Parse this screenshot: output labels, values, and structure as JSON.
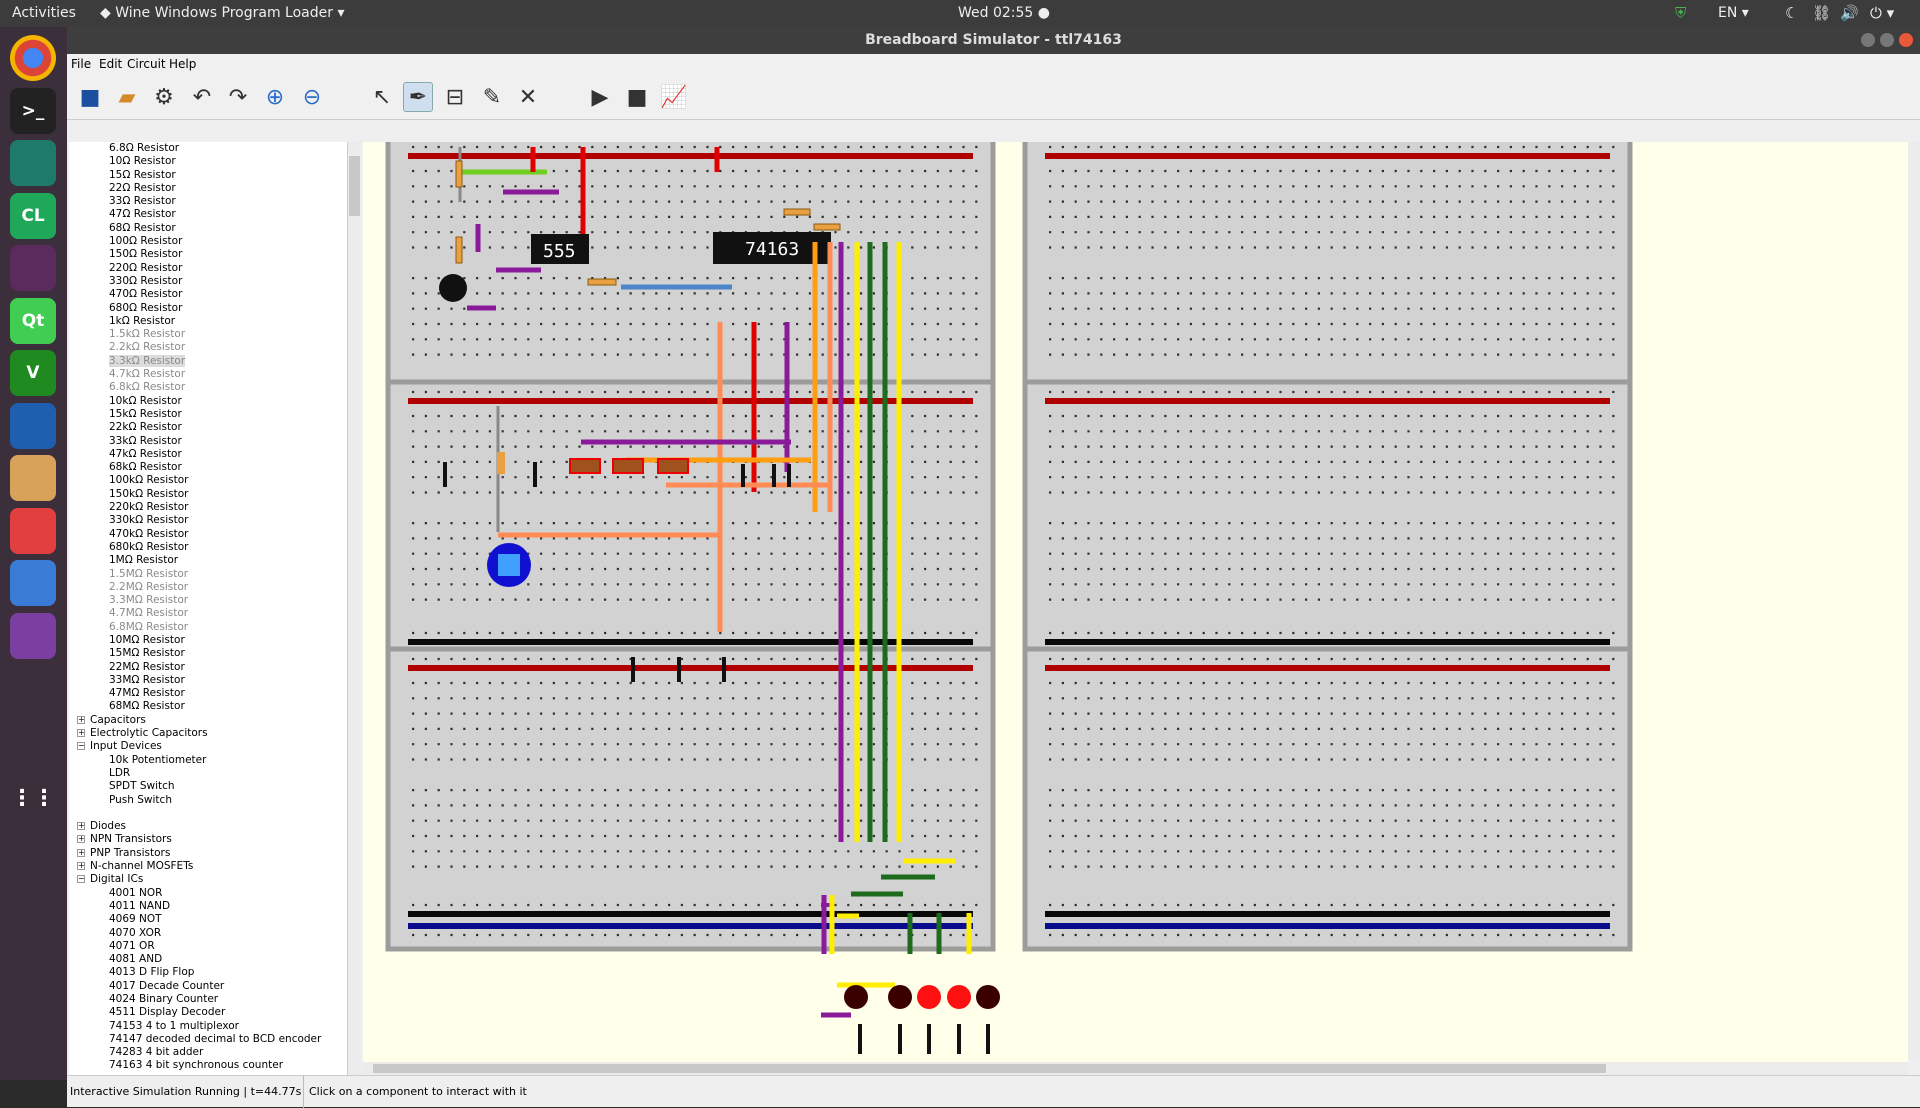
{
  "topbar": {
    "activities": "Activities",
    "app": "Wine Windows Program Loader",
    "clock": "Wed 02:55",
    "lang": "EN"
  },
  "launcher": [
    {
      "icon": "chrome-icon",
      "label": ""
    },
    {
      "icon": "terminal-icon",
      "label": ">_"
    },
    {
      "icon": "atom-icon",
      "label": ""
    },
    {
      "icon": "clion-icon",
      "label": "CL"
    },
    {
      "icon": "github-icon",
      "label": ""
    },
    {
      "icon": "qt-icon",
      "label": "Qt"
    },
    {
      "icon": "vim-icon",
      "label": "V"
    },
    {
      "icon": "writer-icon",
      "label": ""
    },
    {
      "icon": "files-icon",
      "label": ""
    },
    {
      "icon": "pdf-icon",
      "label": ""
    },
    {
      "icon": "editor-icon",
      "label": ""
    },
    {
      "icon": "wine-icon",
      "label": ""
    },
    {
      "icon": "apps-grid-icon",
      "label": ""
    }
  ],
  "window": {
    "title": "Breadboard Simulator - ttl74163"
  },
  "menu": {
    "file": "File",
    "edit": "Edit",
    "circuit": "Circuit",
    "help": "Help"
  },
  "tree": [
    {
      "text": "6.8Ω Resistor",
      "level": 2
    },
    {
      "text": "10Ω Resistor",
      "level": 2
    },
    {
      "text": "15Ω Resistor",
      "level": 2
    },
    {
      "text": "22Ω Resistor",
      "level": 2
    },
    {
      "text": "33Ω Resistor",
      "level": 2
    },
    {
      "text": "47Ω Resistor",
      "level": 2
    },
    {
      "text": "68Ω Resistor",
      "level": 2
    },
    {
      "text": "100Ω Resistor",
      "level": 2
    },
    {
      "text": "150Ω Resistor",
      "level": 2
    },
    {
      "text": "220Ω Resistor",
      "level": 2
    },
    {
      "text": "330Ω Resistor",
      "level": 2
    },
    {
      "text": "470Ω Resistor",
      "level": 2
    },
    {
      "text": "680Ω Resistor",
      "level": 2
    },
    {
      "text": "1kΩ Resistor",
      "level": 2
    },
    {
      "text": "1.5kΩ Resistor",
      "level": 2,
      "dim": true
    },
    {
      "text": "2.2kΩ Resistor",
      "level": 2,
      "dim": true
    },
    {
      "text": "3.3kΩ Resistor",
      "level": 2,
      "dim": true,
      "sel": true
    },
    {
      "text": "4.7kΩ Resistor",
      "level": 2,
      "dim": true
    },
    {
      "text": "6.8kΩ Resistor",
      "level": 2,
      "dim": true
    },
    {
      "text": "10kΩ Resistor",
      "level": 2
    },
    {
      "text": "15kΩ Resistor",
      "level": 2
    },
    {
      "text": "22kΩ Resistor",
      "level": 2
    },
    {
      "text": "33kΩ Resistor",
      "level": 2
    },
    {
      "text": "47kΩ Resistor",
      "level": 2
    },
    {
      "text": "68kΩ Resistor",
      "level": 2
    },
    {
      "text": "100kΩ Resistor",
      "level": 2
    },
    {
      "text": "150kΩ Resistor",
      "level": 2
    },
    {
      "text": "220kΩ Resistor",
      "level": 2
    },
    {
      "text": "330kΩ Resistor",
      "level": 2
    },
    {
      "text": "470kΩ Resistor",
      "level": 2
    },
    {
      "text": "680kΩ Resistor",
      "level": 2
    },
    {
      "text": "1MΩ Resistor",
      "level": 2
    },
    {
      "text": "1.5MΩ Resistor",
      "level": 2,
      "dim": true
    },
    {
      "text": "2.2MΩ Resistor",
      "level": 2,
      "dim": true
    },
    {
      "text": "3.3MΩ Resistor",
      "level": 2,
      "dim": true
    },
    {
      "text": "4.7MΩ Resistor",
      "level": 2,
      "dim": true
    },
    {
      "text": "6.8MΩ Resistor",
      "level": 2,
      "dim": true
    },
    {
      "text": "10MΩ Resistor",
      "level": 2
    },
    {
      "text": "15MΩ Resistor",
      "level": 2
    },
    {
      "text": "22MΩ Resistor",
      "level": 2
    },
    {
      "text": "33MΩ Resistor",
      "level": 2
    },
    {
      "text": "47MΩ Resistor",
      "level": 2
    },
    {
      "text": "68MΩ Resistor",
      "level": 2
    },
    {
      "text": "Capacitors",
      "level": 1,
      "exp": "+"
    },
    {
      "text": "Electrolytic Capacitors",
      "level": 1,
      "exp": "+"
    },
    {
      "text": "Input Devices",
      "level": 1,
      "exp": "−"
    },
    {
      "text": "10k Potentiometer",
      "level": 2
    },
    {
      "text": "LDR",
      "level": 2
    },
    {
      "text": "SPDT Switch",
      "level": 2
    },
    {
      "text": "Push Switch",
      "level": 2
    },
    {
      "text": "",
      "level": 2
    },
    {
      "text": "Diodes",
      "level": 1,
      "exp": "+"
    },
    {
      "text": "NPN Transistors",
      "level": 1,
      "exp": "+"
    },
    {
      "text": "PNP Transistors",
      "level": 1,
      "exp": "+"
    },
    {
      "text": "N-channel MOSFETs",
      "level": 1,
      "exp": "+"
    },
    {
      "text": "Digital ICs",
      "level": 1,
      "exp": "−"
    },
    {
      "text": "4001 NOR",
      "level": 2
    },
    {
      "text": "4011 NAND",
      "level": 2
    },
    {
      "text": "4069 NOT",
      "level": 2
    },
    {
      "text": "4070 XOR",
      "level": 2
    },
    {
      "text": "4071 OR",
      "level": 2
    },
    {
      "text": "4081 AND",
      "level": 2
    },
    {
      "text": "4013 D Flip Flop",
      "level": 2
    },
    {
      "text": "4017 Decade Counter",
      "level": 2
    },
    {
      "text": "4024 Binary Counter",
      "level": 2
    },
    {
      "text": "4511 Display Decoder",
      "level": 2
    },
    {
      "text": "74153 4 to 1 multiplexor",
      "level": 2
    },
    {
      "text": "74147 decoded decimal to BCD encoder",
      "level": 2
    },
    {
      "text": "74283 4 bit adder",
      "level": 2
    },
    {
      "text": "74163 4 bit synchronous counter",
      "level": 2
    }
  ],
  "circuit": {
    "ic1": "555",
    "ic2": "74163"
  },
  "status": {
    "left": "Interactive Simulation Running | t=44.77s",
    "right": "Click on a component to interact with it"
  },
  "colors": {
    "rail_pos": "#b00000",
    "rail_neg": "#0a0a8c",
    "wire_purple": "#8a1a9a",
    "wire_orange": "#ff9933",
    "wire_yellow": "#ffee00",
    "wire_green": "#1e6b1e",
    "wire_red": "#e00000"
  }
}
